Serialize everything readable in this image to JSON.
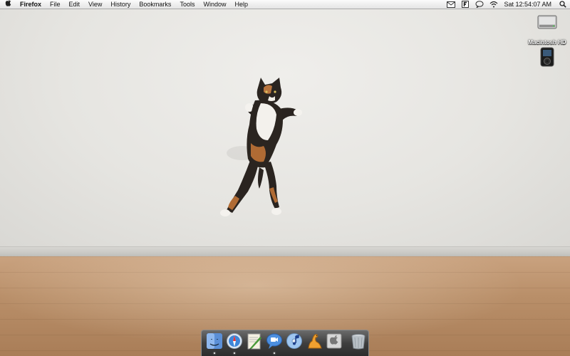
{
  "menubar": {
    "apple_icon": "apple-icon",
    "app_name": "Firefox",
    "menus": [
      "File",
      "Edit",
      "View",
      "History",
      "Bookmarks",
      "Tools",
      "Window",
      "Help"
    ],
    "status_icons": [
      "mail-icon",
      "f-badge-icon",
      "chat-bubble-icon",
      "wifi-icon"
    ],
    "clock": "Sat 12:54:07 AM",
    "spotlight_icon": "spotlight-search-icon"
  },
  "desktop": {
    "icons": [
      {
        "label": "Macintosh HD",
        "icon": "hard-drive-icon"
      },
      {
        "label": "",
        "icon": "ipod-icon"
      }
    ],
    "wallpaper": "jumping-cat-photo"
  },
  "dock": {
    "items": [
      {
        "name": "finder",
        "icon": "finder-icon",
        "running": true
      },
      {
        "name": "safari",
        "icon": "safari-compass-icon",
        "running": true
      },
      {
        "name": "textedit",
        "icon": "pen-document-icon",
        "running": false
      },
      {
        "name": "ichat",
        "icon": "chat-bubble-icon",
        "running": true
      },
      {
        "name": "itunes",
        "icon": "music-cd-icon",
        "running": false
      },
      {
        "name": "camino",
        "icon": "dinosaur-icon",
        "running": false
      },
      {
        "name": "system-preferences",
        "icon": "preferences-icon",
        "running": false
      }
    ],
    "trash_icon": "trash-icon"
  },
  "colors": {
    "menubar_bg": "#ececec",
    "dock_bg": "#3f3f3f",
    "wall": "#e6e5e1",
    "floor": "#b98f69"
  }
}
